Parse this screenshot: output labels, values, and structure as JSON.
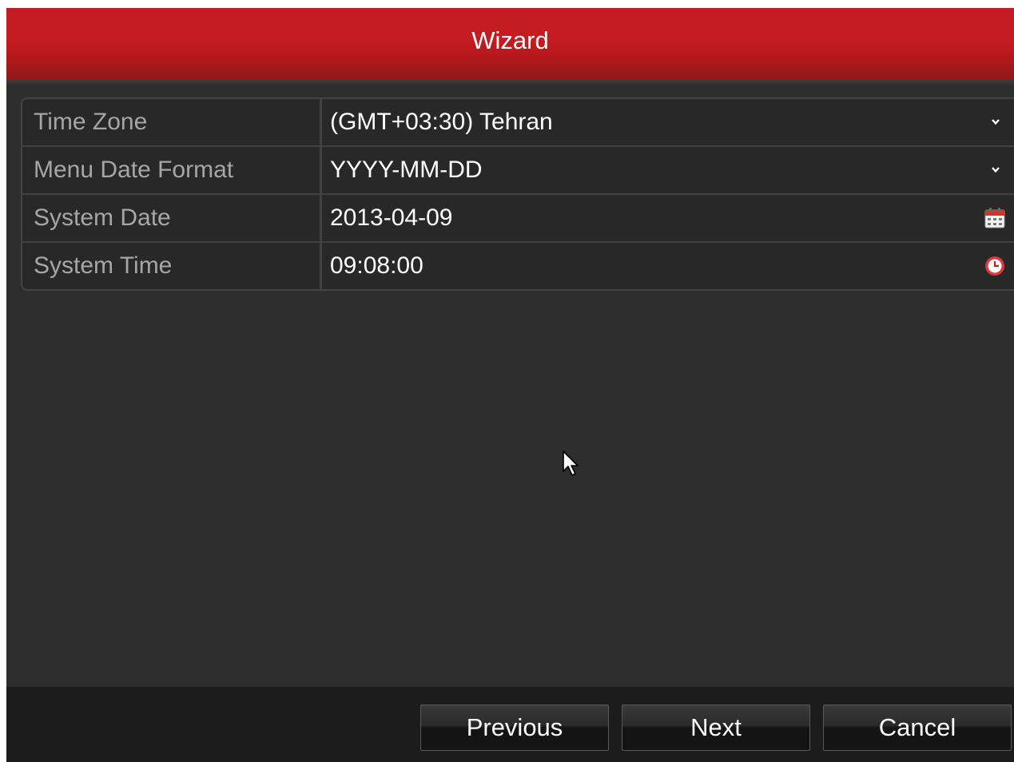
{
  "dialog": {
    "title": "Wizard"
  },
  "form": {
    "rows": [
      {
        "label": "Time Zone",
        "value": "(GMT+03:30) Tehran",
        "control": "dropdown"
      },
      {
        "label": "Menu Date Format",
        "value": "YYYY-MM-DD",
        "control": "dropdown"
      },
      {
        "label": "System Date",
        "value": "2013-04-09",
        "control": "calendar"
      },
      {
        "label": "System Time",
        "value": "09:08:00",
        "control": "clock"
      }
    ]
  },
  "footer": {
    "previous_label": "Previous",
    "next_label": "Next",
    "cancel_label": "Cancel"
  },
  "colors": {
    "title_bar": "#c41c20",
    "panel_background": "#2e2e2e",
    "label_text": "#a6a6a6",
    "value_text": "#ffffff",
    "footer_background": "#1c1c1c"
  },
  "icons": [
    "chevron-down-icon",
    "calendar-icon",
    "clock-icon",
    "mouse-cursor-icon"
  ]
}
